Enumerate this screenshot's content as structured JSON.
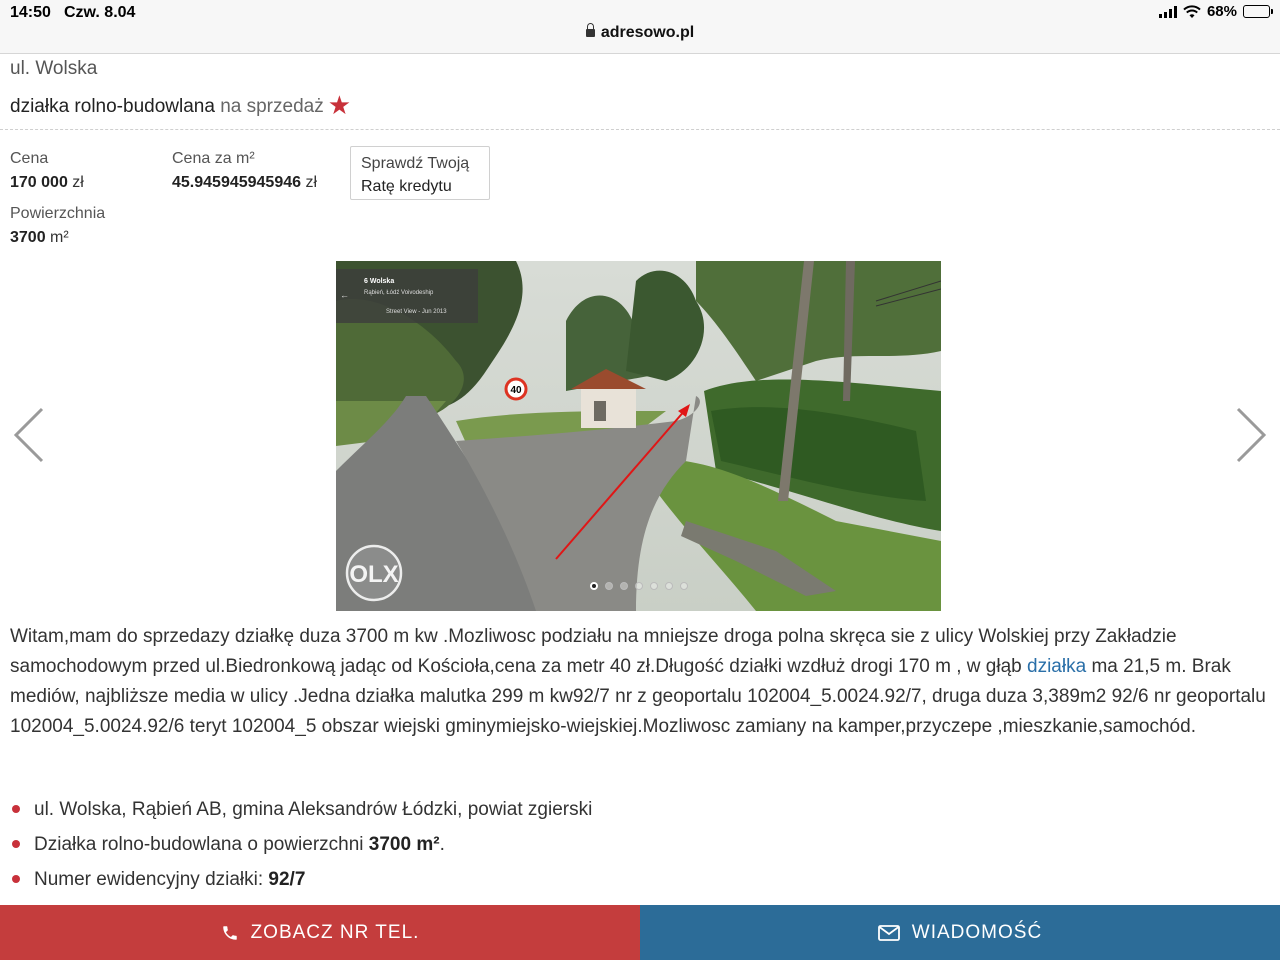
{
  "status_bar": {
    "time": "14:50",
    "date": "Czw. 8.04",
    "battery": "68%",
    "battery_level": 0.68,
    "url": "adresowo.pl"
  },
  "listing": {
    "street": "ul. Wolska",
    "title_bold": "działka rolno-budowlana",
    "title_rest": " na sprzedaż",
    "price_label": "Cena",
    "price_value": "170 000",
    "price_unit": " zł",
    "price_m2_label": "Cena za m²",
    "price_m2_value": "45.945945945946",
    "price_m2_unit": " zł",
    "credit_line1": "Sprawdź Twoją",
    "credit_line2": "Ratę kredytu",
    "area_label": "Powierzchnia",
    "area_value": "3700",
    "area_unit": " m²"
  },
  "gallery": {
    "sv_title": "6 Wolska",
    "sv_sub": "Rąbień, Łódź Voivodeship",
    "sv_date": "Street View - Jun 2013",
    "speed_sign": "40",
    "watermark": "OLX",
    "dot_count": 7,
    "active_index": 0
  },
  "description": {
    "part1": "Witam,mam do sprzedazy działkę duza 3700 m kw .Mozliwosc podziału na mniejsze droga polna skręca sie z ulicy Wolskiej przy Zakładzie samochodowym przed ul.Biedronkową jadąc od Kościoła,cena za metr 40 zł.Długość działki wzdłuż drogi 170 m , w głąb ",
    "link": "działka",
    "part2": " ma 21,5 m. Brak mediów, najbliższe media w ulicy .Jedna działka malutka 299 m kw92/7 nr z geoportalu 102004_5.0024.92/7, druga duza 3,389m2 92/6 nr geoportalu 102004_5.0024.92/6 teryt 102004_5 obszar wiejski gminymiejsko-wiejskiej.Mozliwosc zamiany na kamper,przyczepe ,mieszkanie,samochód."
  },
  "details": {
    "location": "ul. Wolska, Rąbień AB, gmina Aleksandrów Łódzki, powiat zgierski",
    "type_prefix": "Działka rolno-budowlana o powierzchni ",
    "type_area": "3700 m²",
    "type_suffix": ".",
    "parcel_label": "Numer ewidencyjny działki: ",
    "parcel_value": "92/7"
  },
  "actions": {
    "phone": "ZOBACZ NR TEL.",
    "message": "WIADOMOŚĆ"
  },
  "colors": {
    "accent_red": "#c43d3d",
    "accent_blue": "#2c6c98",
    "link": "#2a6fa8"
  }
}
